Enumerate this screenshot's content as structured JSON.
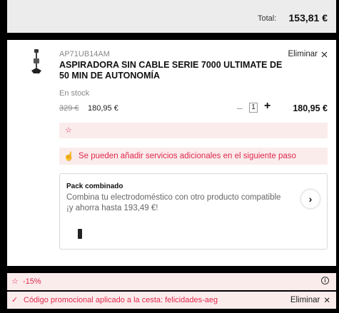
{
  "summary": {
    "total_label": "Total:",
    "total_value": "153,81 €"
  },
  "product": {
    "sku": "AP71UB14AM",
    "title": "ASPIRADORA SIN CABLE SERIE 7000 ULTIMATE DE 50 MIN DE AUTONOMÍA",
    "stock": "En stock",
    "old_price": "329 €",
    "new_price": "180,95 €",
    "remove_label": "Eliminar",
    "remove_icon": "close-icon",
    "quantity": "1",
    "minus_label": "–",
    "plus_label": "+",
    "line_total": "180,95 €"
  },
  "promo_star_row": {
    "icon": "star-icon",
    "star_glyph": "☆"
  },
  "services": {
    "icon": "hand-pointer-icon",
    "hand_glyph": "☝",
    "text": "Se pueden añadir servicios adicionales en el siguiente paso"
  },
  "pack": {
    "title": "Pack combinado",
    "description": "Combina tu electrodoméstico con otro producto compatible ¡y ahorra hasta 193,49 €!",
    "arrow_icon": "chevron-right-icon",
    "arrow_glyph": "›"
  },
  "discount": {
    "star_glyph": "☆",
    "percent": "-15%",
    "info_glyph": "i"
  },
  "coupon": {
    "check_glyph": "✓",
    "message": "Código promocional aplicado a la cesta: felicidades-aeg",
    "remove_label": "Eliminar",
    "remove_glyph": "✕"
  },
  "colors": {
    "accent": "#e0284b",
    "promo_background": "#fbecec",
    "summary_background": "#ececec"
  }
}
